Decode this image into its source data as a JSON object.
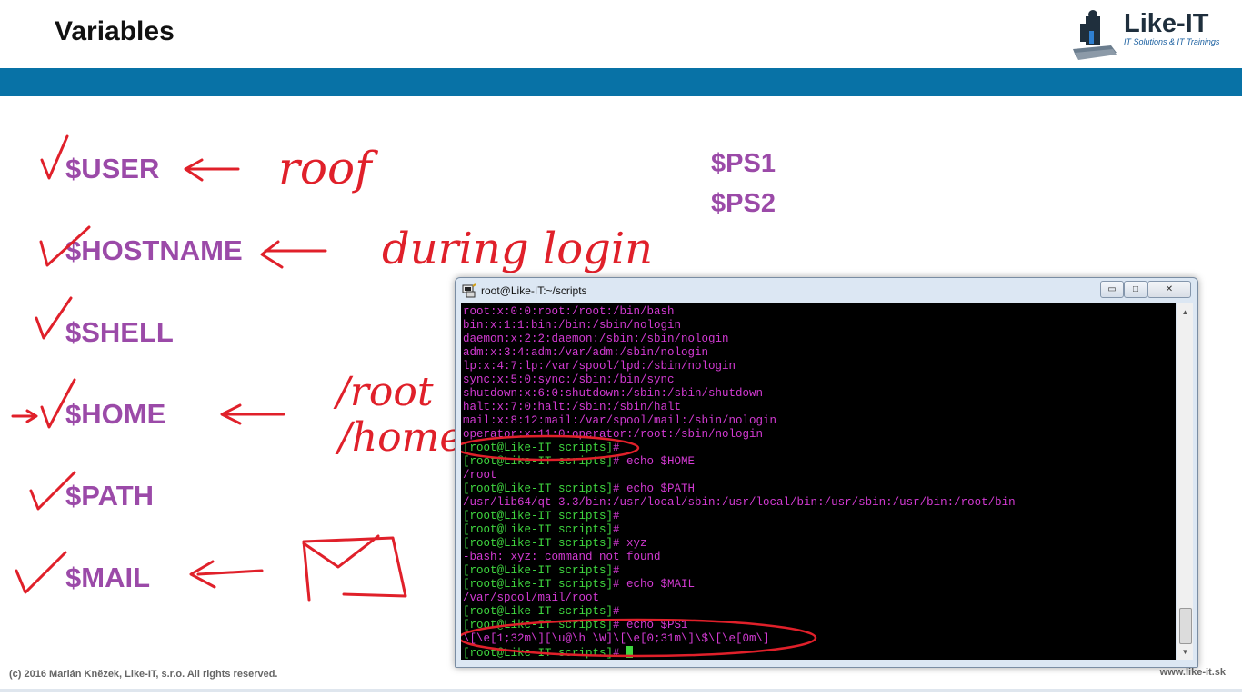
{
  "slide": {
    "title": "Variables",
    "logo": {
      "name": "Like-IT",
      "tagline": "IT Solutions & IT Trainings"
    },
    "variables": [
      "$USER",
      "$HOSTNAME",
      "$SHELL",
      "$HOME",
      "$PATH",
      "$MAIL"
    ],
    "prompt_vars": [
      "$PS1",
      "$PS2"
    ],
    "annotations": {
      "user": "roof",
      "hostname": "during login",
      "home_1": "/root",
      "home_2": "/home"
    },
    "footer": {
      "copyright": "(c) 2016 Marián Knězek, Like-IT, s.r.o. All rights reserved.",
      "website": "www.like-it.sk"
    }
  },
  "terminal": {
    "title": "root@Like-IT:~/scripts",
    "buttons": {
      "minimize": "▭",
      "maximize": "□",
      "close": "✕"
    },
    "lines": [
      {
        "text": "root:x:0:0:root:/root:/bin/bash"
      },
      {
        "text": "bin:x:1:1:bin:/bin:/sbin/nologin"
      },
      {
        "text": "daemon:x:2:2:daemon:/sbin:/sbin/nologin"
      },
      {
        "text": "adm:x:3:4:adm:/var/adm:/sbin/nologin"
      },
      {
        "text": "lp:x:4:7:lp:/var/spool/lpd:/sbin/nologin"
      },
      {
        "text": "sync:x:5:0:sync:/sbin:/bin/sync"
      },
      {
        "text": "shutdown:x:6:0:shutdown:/sbin:/sbin/shutdown"
      },
      {
        "text": "halt:x:7:0:halt:/sbin:/sbin/halt"
      },
      {
        "text": "mail:x:8:12:mail:/var/spool/mail:/sbin/nologin"
      },
      {
        "text": "operator:x:11:0:operator:/root:/sbin/nologin"
      },
      {
        "prompt": "[root@Like-IT scripts]",
        "cmd": "# "
      },
      {
        "prompt": "[root@Like-IT scripts]",
        "cmd": "# echo $HOME"
      },
      {
        "text": "/root"
      },
      {
        "prompt": "[root@Like-IT scripts]",
        "cmd": "# echo $PATH"
      },
      {
        "text": "/usr/lib64/qt-3.3/bin:/usr/local/sbin:/usr/local/bin:/usr/sbin:/usr/bin:/root/bin"
      },
      {
        "prompt": "[root@Like-IT scripts]",
        "cmd": "#"
      },
      {
        "prompt": "[root@Like-IT scripts]",
        "cmd": "#"
      },
      {
        "prompt": "[root@Like-IT scripts]",
        "cmd": "# xyz"
      },
      {
        "text": "-bash: xyz: command not found"
      },
      {
        "prompt": "[root@Like-IT scripts]",
        "cmd": "#"
      },
      {
        "prompt": "[root@Like-IT scripts]",
        "cmd": "# echo $MAIL"
      },
      {
        "text": "/var/spool/mail/root"
      },
      {
        "prompt": "[root@Like-IT scripts]",
        "cmd": "#"
      },
      {
        "prompt": "[root@Like-IT scripts]",
        "cmd": "# echo $PS1"
      },
      {
        "text": "\\[\\e[1;32m\\][\\u@\\h \\W]\\[\\e[0;31m\\]\\$\\[\\e[0m\\]"
      },
      {
        "prompt": "[root@Like-IT scripts]",
        "cmd": "# ",
        "cursor": true
      }
    ]
  },
  "colors": {
    "accent_band": "#0872a6",
    "variable_text": "#9b4aa8",
    "ink_red": "#e0202a",
    "prompt_green": "#3fd63f",
    "terminal_magenta": "#d33ad3"
  }
}
